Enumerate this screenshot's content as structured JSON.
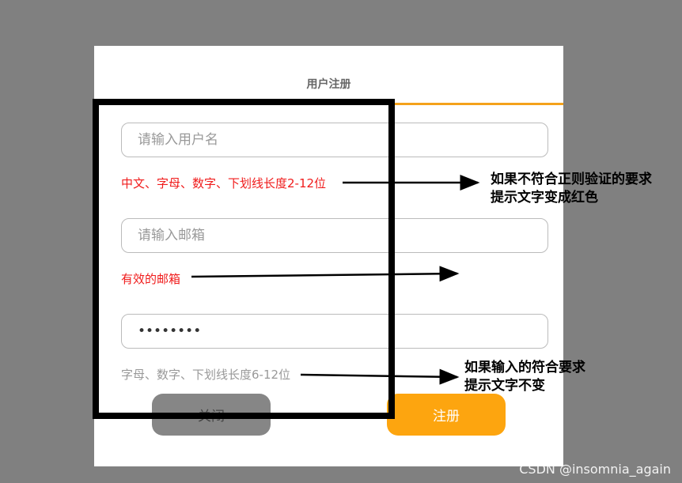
{
  "dialog": {
    "title": "用户注册",
    "username": {
      "placeholder": "请输入用户名",
      "value": ""
    },
    "username_hint": "中文、字母、数字、下划线长度2-12位",
    "email": {
      "placeholder": "请输入邮箱",
      "value": ""
    },
    "email_hint": "有效的邮箱",
    "password": {
      "placeholder": "",
      "value": "••••••••"
    },
    "password_hint": "字母、数字、下划线长度6-12位",
    "close_label": "关闭",
    "register_label": "注册"
  },
  "annotations": {
    "note_red_line1": "如果不符合正则验证的要求",
    "note_red_line2": "提示文字变成红色",
    "note_ok_line1": "如果输入的符合要求",
    "note_ok_line2": "提示文字不变"
  },
  "watermark": "CSDN @insomnia_again",
  "colors": {
    "accent": "#f4a21b",
    "error": "#f01b1b",
    "register_button": "#fda50f",
    "close_button": "#868686",
    "backdrop": "#808080"
  }
}
